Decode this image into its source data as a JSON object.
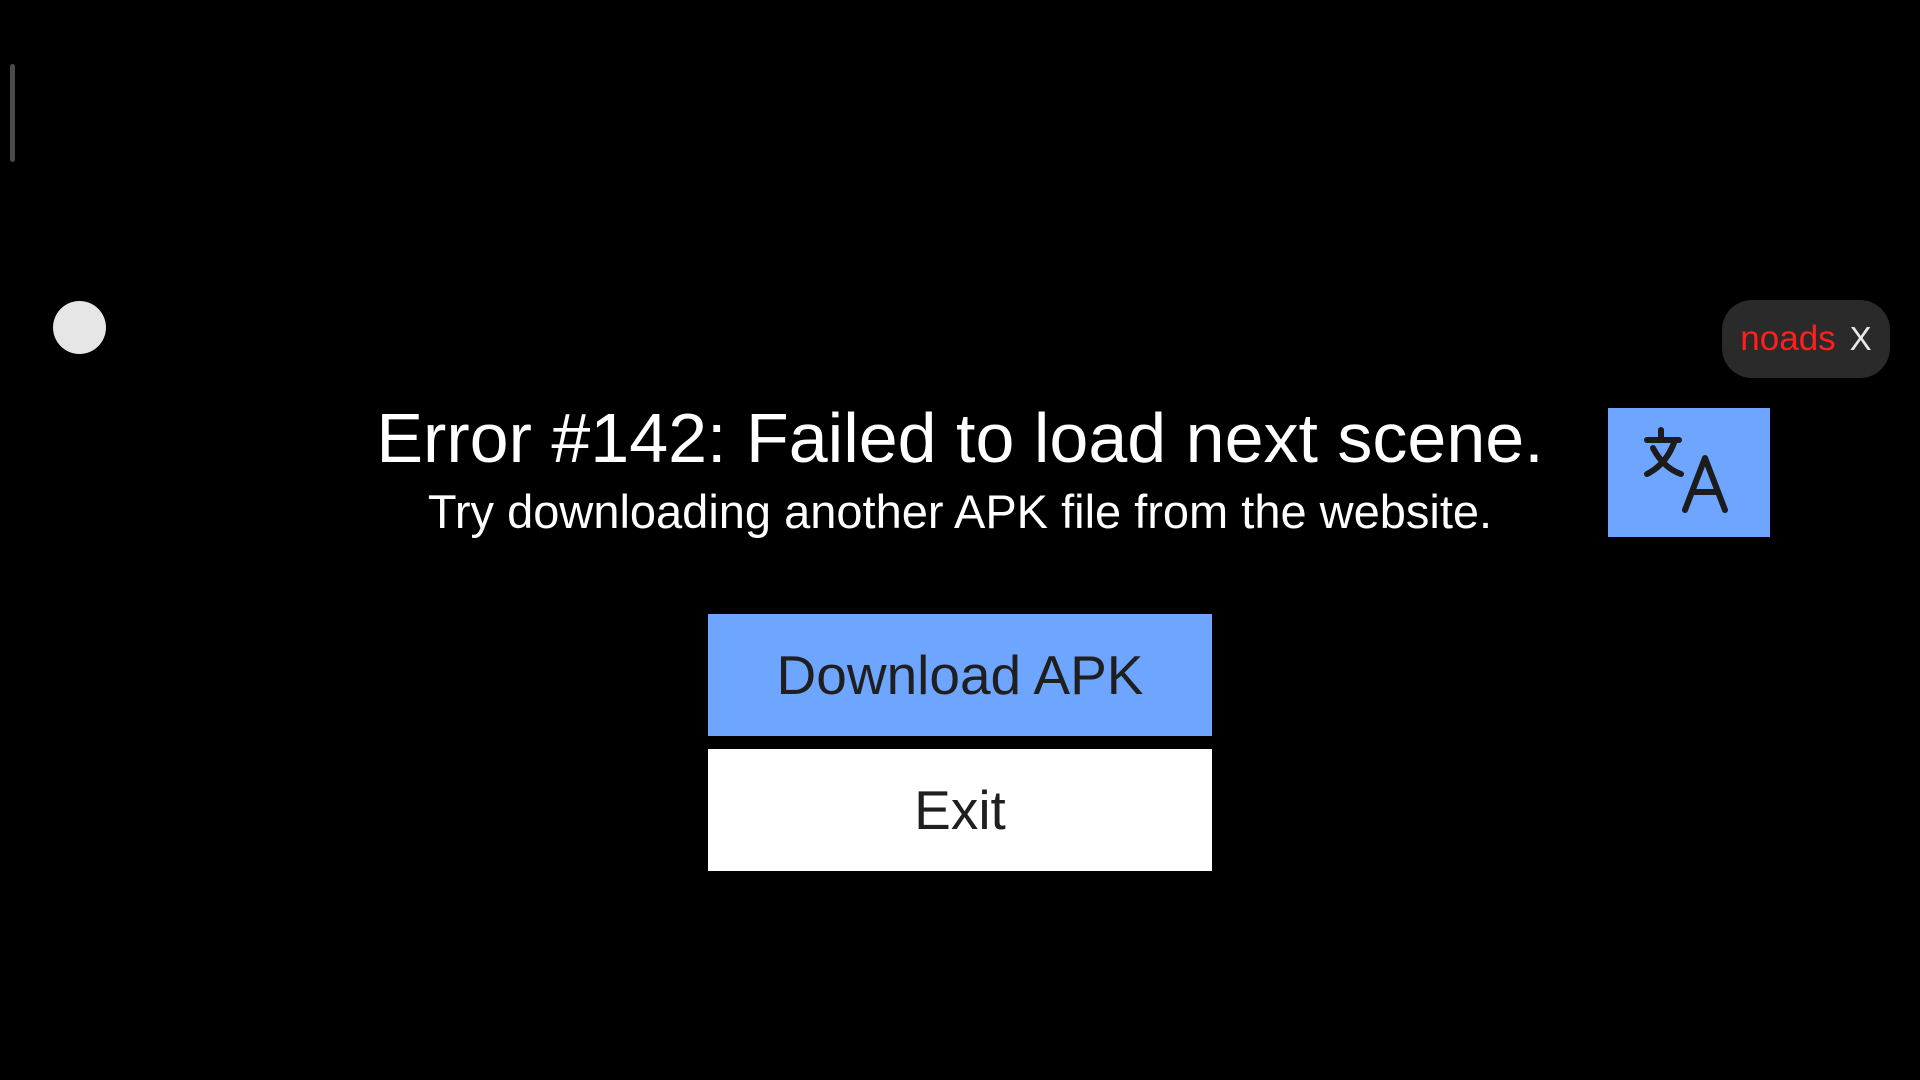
{
  "overlay": {
    "noads_label": "noads",
    "noads_close": "X"
  },
  "error": {
    "title": "Error #142: Failed to load next scene.",
    "subtitle": "Try downloading another APK file from the website."
  },
  "actions": {
    "download_label": "Download APK",
    "exit_label": "Exit"
  },
  "icons": {
    "translate": "translate-icon"
  },
  "colors": {
    "background": "#000000",
    "accent_blue": "#6ea6ff",
    "noads_red": "#ff1f1f",
    "pill_bg": "#2a2a2a"
  }
}
